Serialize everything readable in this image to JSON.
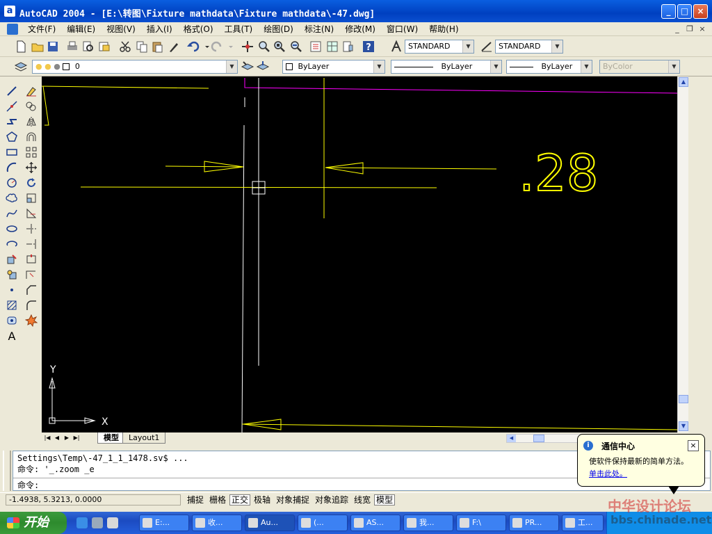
{
  "window": {
    "icon_label": "a",
    "title": "AutoCAD 2004 - [E:\\转图\\Fixture mathdata\\Fixture mathdata\\-47.dwg]",
    "minimize": "_",
    "maximize": "□",
    "close": "×"
  },
  "menu": {
    "items": [
      "文件(F)",
      "编辑(E)",
      "视图(V)",
      "插入(I)",
      "格式(O)",
      "工具(T)",
      "绘图(D)",
      "标注(N)",
      "修改(M)",
      "窗口(W)",
      "帮助(H)"
    ],
    "mdi_min": "_",
    "mdi_restore": "❐",
    "mdi_close": "×"
  },
  "toolbar": {
    "text_style": "STANDARD",
    "dim_style": "STANDARD",
    "layer": "0",
    "color": "ByLayer",
    "linetype": "ByLayer",
    "lineweight": "ByLayer",
    "plotstyle": "ByColor"
  },
  "drawing": {
    "dimension_text": ".28",
    "ucs_x": "X",
    "ucs_y": "Y",
    "colors": {
      "background": "#000000",
      "yellow": "#ffff00",
      "magenta": "#ff00ff",
      "white": "#ffffff"
    }
  },
  "tabs": {
    "model": "模型",
    "layout1": "Layout1"
  },
  "command": {
    "line1": "Settings\\Temp\\-47_1_1_1478.sv$ ...",
    "line2": "命令: '_.zoom _e",
    "prompt": "命令:"
  },
  "status": {
    "coords": "-1.4938, 5.3213, 0.0000",
    "buttons": [
      {
        "label": "捕捉",
        "on": false
      },
      {
        "label": "栅格",
        "on": false
      },
      {
        "label": "正交",
        "on": true
      },
      {
        "label": "极轴",
        "on": false
      },
      {
        "label": "对象捕捉",
        "on": false
      },
      {
        "label": "对象追踪",
        "on": false
      },
      {
        "label": "线宽",
        "on": false
      },
      {
        "label": "模型",
        "on": true
      }
    ]
  },
  "balloon": {
    "title": "通信中心",
    "text": "使软件保持最新的简单方法。",
    "link": "单击此处。",
    "close": "×"
  },
  "taskbar": {
    "start": "开始",
    "tasks": [
      "E:...",
      "收...",
      "Au...",
      "(...",
      "AS...",
      "我...",
      "F:\\",
      "PR...",
      "工..."
    ]
  },
  "watermark": {
    "line1": "中华设计论坛",
    "line2": "bbs.chinade.net"
  }
}
